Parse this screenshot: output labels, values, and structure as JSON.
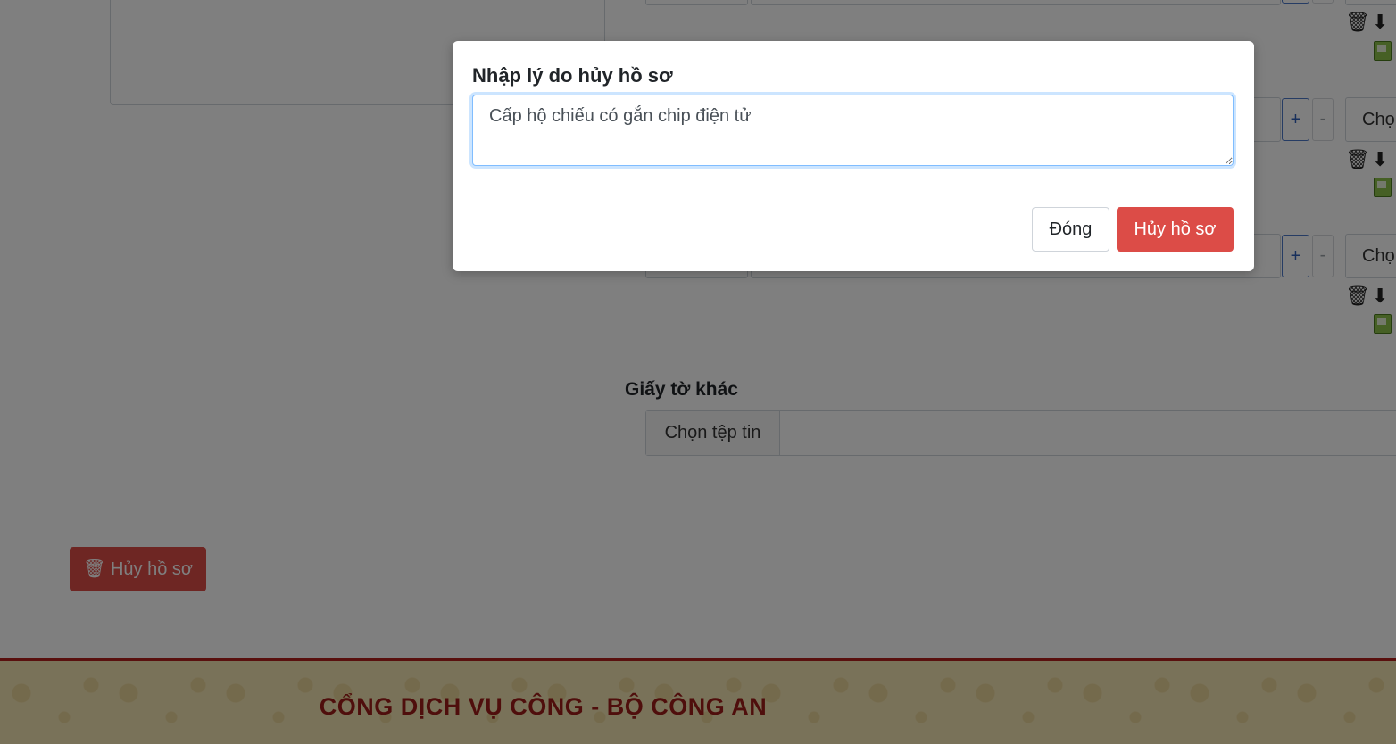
{
  "files": {
    "rows": [
      {
        "plus": "+",
        "minus": "-",
        "select_label": "Chọn"
      },
      {
        "plus": "+",
        "minus": "-",
        "select_label": "Chọn"
      }
    ],
    "icons": {
      "delete": "trash-icon",
      "download": "download-icon",
      "preview": "image-icon"
    }
  },
  "other_documents": {
    "title": "Giấy tờ khác",
    "choose_file_label": "Chọn tệp tin"
  },
  "main_actions": {
    "cancel_label": "Hủy hồ sơ",
    "cancel_icon": "trash-icon"
  },
  "footer": {
    "title": "CỔNG DỊCH VỤ CÔNG - BỘ CÔNG AN"
  },
  "modal": {
    "title": "Nhập lý do hủy hồ sơ",
    "reason_value": "Cấp hộ chiếu có gắn chip điện tử",
    "close_label": "Đóng",
    "confirm_label": "Hủy hồ sơ"
  },
  "colors": {
    "danger": "#dc4c47",
    "primary_outline": "#4d78c9",
    "footer_bg": "#f3e4b3",
    "footer_text": "#9e1c18"
  }
}
